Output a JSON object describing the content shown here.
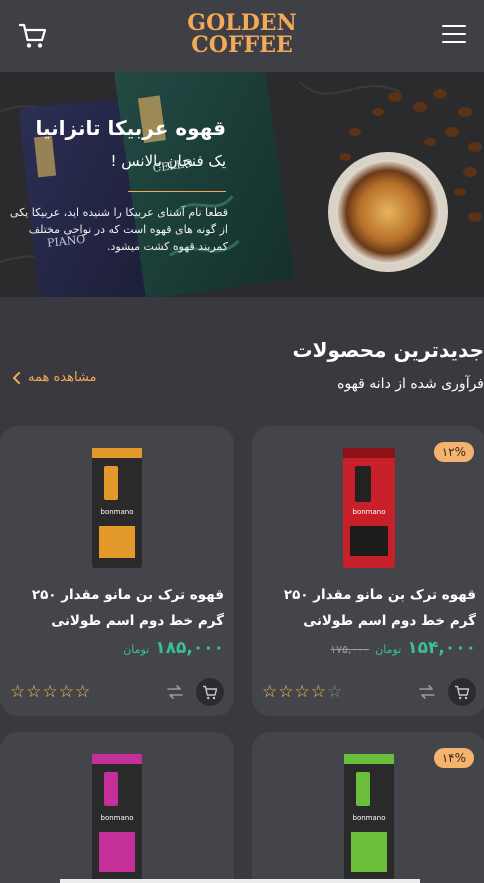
{
  "header": {
    "logo_line1": "GOLDEN",
    "logo_line2": "COFFEE",
    "cart_icon": "cart-icon",
    "menu_icon": "hamburger-menu-icon"
  },
  "hero": {
    "title": "قهوه عربیکا تانزانیا",
    "subtitle": "یک فنجان بالانس !",
    "description": "قطعا نام آشنای عربیکا را شنیده اید، عربیکا یکی از گونه های قهوه است که در نواحی مختلف کمربند قهوه کشت میشود.",
    "bag_label_1": "PIANO",
    "bag_label_2": "CELLO"
  },
  "section": {
    "title": "جدیدترین محصولات",
    "subtitle": "فرآوری شده از دانه قهوه",
    "see_all": "مشاهده همه"
  },
  "products": [
    {
      "discount": "۱۲%",
      "name": "قهوه ترک بن مانو مقدار ۲۵۰ گرم خط دوم اسم طولانی",
      "price": "۱۵۴,۰۰۰",
      "unit": "تومان",
      "old_price": "۱۷۵,۰۰۰",
      "brand": "bonmano",
      "bag_color": "#c8202a",
      "rating": 4
    },
    {
      "discount": "",
      "name": "قهوه ترک بن مانو مقدار ۲۵۰ گرم خط دوم اسم طولانی",
      "price": "۱۸۵,۰۰۰",
      "unit": "تومان",
      "old_price": "",
      "brand": "bonmano",
      "bag_color": "#e49a2a",
      "rating": 5
    },
    {
      "discount": "۱۴%",
      "brand": "bonmano",
      "bag_color": "#6cbf3a"
    },
    {
      "discount": "",
      "brand": "bonmano",
      "bag_color": "#c42f9a"
    }
  ]
}
